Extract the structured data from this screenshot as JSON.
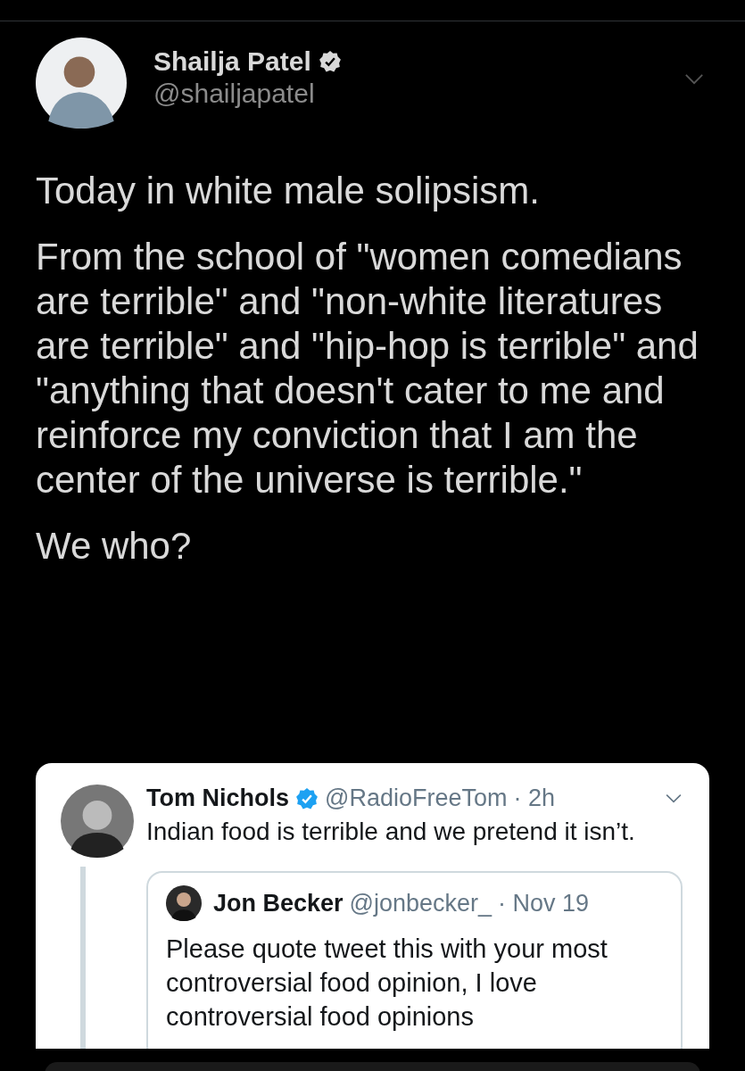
{
  "author": {
    "name": "Shailja Patel",
    "verified": true,
    "handle": "@shailjapatel"
  },
  "paragraphs": [
    "Today in white male solipsism.",
    "From the school of \"women comedians are terrible\" and \"non-white literatures are terrible\" and \"hip-hop is terrible\" and \"anything that doesn't cater to me and reinforce my conviction that I am the center of the universe is terrible.\"",
    "We who?"
  ],
  "embedded_screenshot": {
    "tweet": {
      "name": "Tom Nichols",
      "verified": true,
      "handle": "@RadioFreeTom",
      "time": "· 2h",
      "text": "Indian food is terrible and we pretend it isn’t."
    },
    "quoted": {
      "name": "Jon Becker",
      "handle": "@jonbecker_",
      "time": "· Nov 19",
      "text": "Please quote tweet this with your most controversial food opinion, I love controversial food opinions"
    }
  }
}
